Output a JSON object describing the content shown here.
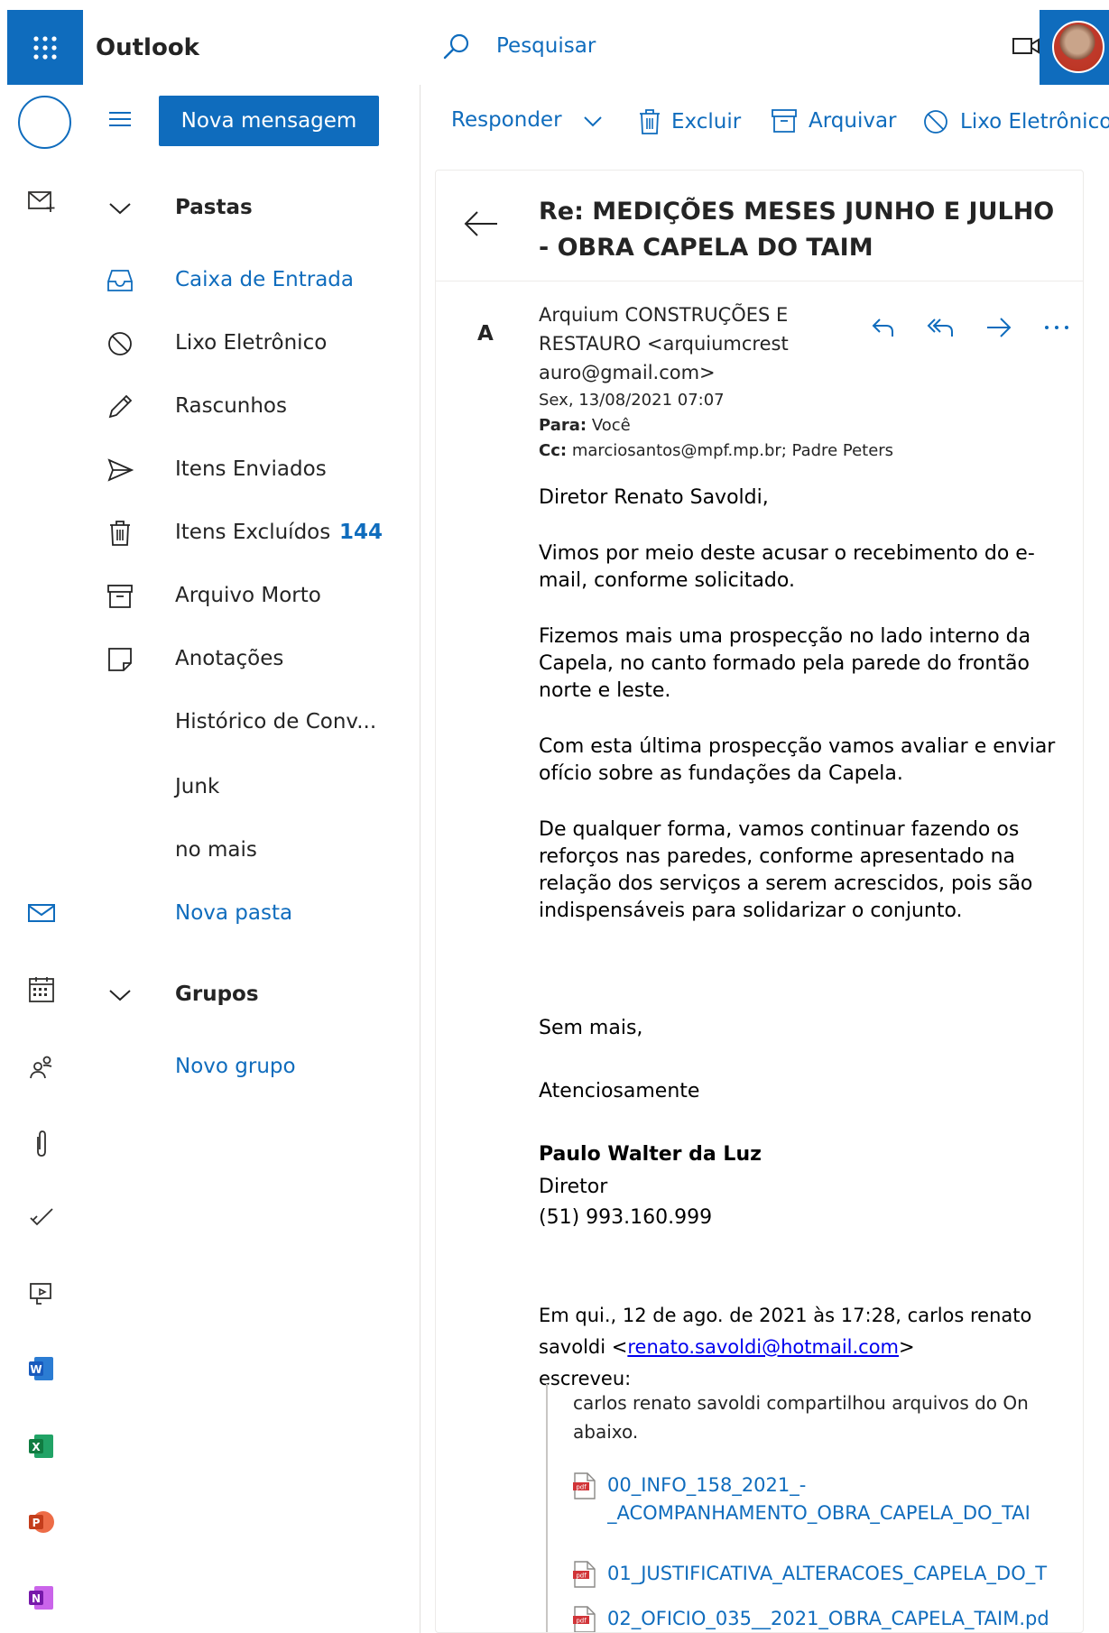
{
  "app": {
    "title": "Outlook",
    "search_label": "Pesquisar"
  },
  "compose": {
    "new_message": "Nova mensagem"
  },
  "folders": {
    "pastas_header": "Pastas",
    "items": [
      {
        "label": "Caixa de Entrada",
        "icon": "inbox-icon"
      },
      {
        "label": "Lixo Eletrônico",
        "icon": "junk-icon"
      },
      {
        "label": "Rascunhos",
        "icon": "pencil-icon"
      },
      {
        "label": "Itens Enviados",
        "icon": "send-icon"
      },
      {
        "label": "Itens Excluídos",
        "icon": "trash-icon",
        "count": "144"
      },
      {
        "label": "Arquivo Morto",
        "icon": "archive-icon"
      },
      {
        "label": "Anotações",
        "icon": "note-icon"
      },
      {
        "label": "Histórico de Conv..."
      },
      {
        "label": "Junk"
      },
      {
        "label": "no mais"
      }
    ],
    "new_folder": "Nova pasta",
    "grupos_header": "Grupos",
    "new_group": "Novo grupo"
  },
  "toolbar": {
    "reply": "Responder",
    "delete": "Excluir",
    "archive": "Arquivar",
    "junk": "Lixo Eletrônico"
  },
  "message": {
    "subject": "Re: MEDIÇÕES MESES JUNHO E JULHO - OBRA CAPELA DO TAIM",
    "initial": "A",
    "sender_line1": "Arquium CONSTRUÇÕES E",
    "sender_line2": "RESTAURO <arquiumcrest",
    "sender_line3": "auro@gmail.com>",
    "date": "Sex, 13/08/2021 07:07",
    "to_label": "Para:",
    "to_value": "Você",
    "cc_label": "Cc:",
    "cc_value": "marciosantos@mpf.mp.br; Padre Peters",
    "body": {
      "greeting": "Diretor Renato Savoldi,",
      "p1": "Vimos por meio deste acusar o recebimento do e-mail, conforme solicitado.",
      "p2": "Fizemos mais uma prospecção no lado interno da Capela, no canto formado pela parede do frontão norte e leste.",
      "p3": "Com esta última prospecção vamos avaliar e enviar ofício sobre as fundações da Capela.",
      "p4": "De qualquer forma, vamos continuar fazendo os reforços nas paredes, conforme apresentado na relação dos serviços a serem acrescidos, pois são indispensáveis para solidarizar o conjunto.",
      "closing1": "Sem mais,",
      "closing2": "Atenciosamente",
      "sig_name": "Paulo Walter da Luz",
      "sig_title": "Diretor",
      "sig_phone": "(51) 993.160.999",
      "quote_intro_a": "Em qui., 12 de ago. de 2021 às 17:28, carlos renato savoldi <",
      "quote_email": "renato.savoldi@hotmail.com",
      "quote_intro_b": ">",
      "quote_intro_c": "escreveu:",
      "quoted_line": "carlos renato savoldi compartilhou arquivos do On abaixo."
    },
    "attachments": [
      {
        "line1": "00_INFO_158_2021_-",
        "line2": "_ACOMPANHAMENTO_OBRA_CAPELA_DO_TAI"
      },
      {
        "line1": "01_JUSTIFICATIVA_ALTERACOES_CAPELA_DO_T"
      },
      {
        "line1": "02_OFICIO_035__2021_OBRA_CAPELA_TAIM.pd"
      }
    ]
  },
  "colors": {
    "accent": "#0f6cbd",
    "text": "#242424"
  }
}
